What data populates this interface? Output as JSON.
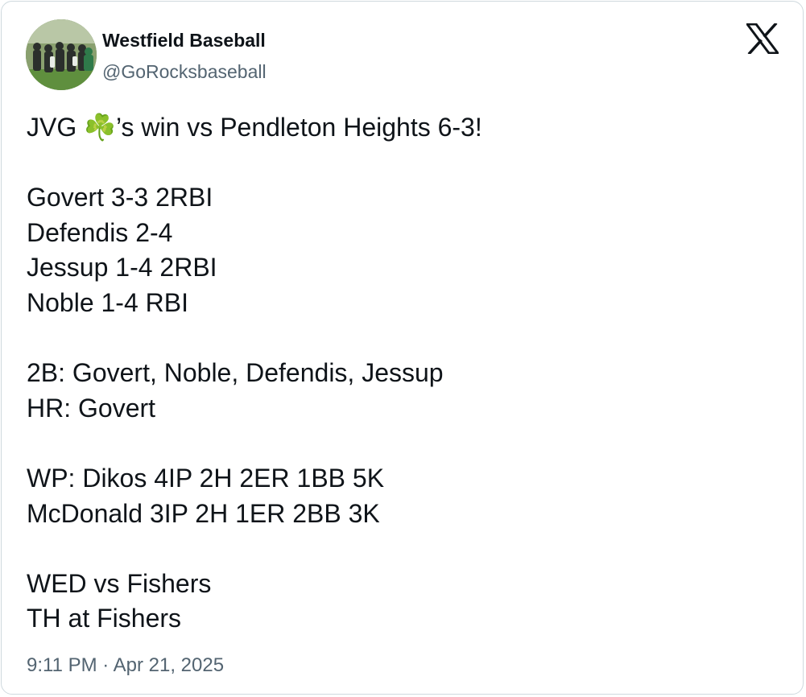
{
  "author": {
    "display_name": "Westfield Baseball",
    "handle": "@GoRocksbaseball"
  },
  "platform_logo_icon": "x-logo-icon",
  "tweet": {
    "lines": [
      "JVG ☘️’s win vs Pendleton Heights 6-3!",
      "",
      "Govert 3-3 2RBI",
      "Defendis 2-4",
      "Jessup 1-4 2RBI",
      "Noble 1-4 RBI",
      "",
      "2B: Govert, Noble, Defendis, Jessup",
      "HR: Govert",
      "",
      "WP: Dikos 4IP 2H 2ER 1BB 5K",
      "McDonald 3IP 2H 1ER 2BB 3K",
      "",
      "WED vs Fishers",
      "TH at Fishers"
    ]
  },
  "timestamp": "9:11 PM · Apr 21, 2025",
  "colors": {
    "text_primary": "#0f1419",
    "text_secondary": "#536471",
    "border": "#cfd9de"
  }
}
